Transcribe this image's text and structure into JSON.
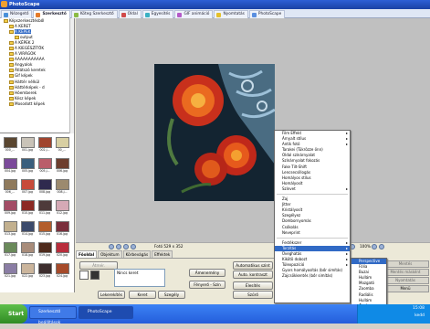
{
  "app": {
    "title": "PhotoScape"
  },
  "tabs": [
    {
      "label": "Nézegető",
      "color": "#4a90d9"
    },
    {
      "label": "Szerkesztő",
      "color": "#e47b2b"
    },
    {
      "label": "Köteg Szerkesztő",
      "color": "#8bbb45"
    },
    {
      "label": "Oldal",
      "color": "#d14a4a"
    },
    {
      "label": "Egyesítés",
      "color": "#3ab0c3"
    },
    {
      "label": "GIF animáció",
      "color": "#b45ac8"
    },
    {
      "label": "Nyomtatás",
      "color": "#e4c02b"
    },
    {
      "label": "PhotoScape",
      "color": "#5a8fe0"
    }
  ],
  "tree": [
    "Képszerkesztésből",
    "A KERET",
    "A KÉPEK",
    "output",
    "A KÉPEK 2",
    "A KIEGÉSZÍTŐK",
    "A VIRÁGOK",
    "AAAAAAAAAAA",
    "Angyalok",
    "Átlátszó keretek",
    "Gif képek",
    "Háttér nélkül",
    "Háttérképek - d",
    "Hóemberek",
    "Kész képek",
    "Mosodott képek"
  ],
  "thumbs": [
    {
      "cap": "000_...",
      "c": "#5a4630"
    },
    {
      "cap": "001.jpg",
      "c": "#c9c3b8"
    },
    {
      "cap": "002.j...",
      "c": "#a0442e"
    },
    {
      "cap": "00_...",
      "c": "#d8cfa2"
    },
    {
      "cap": "004.jpg",
      "c": "#7b4a9a"
    },
    {
      "cap": "005.jpg",
      "c": "#3a5f7d"
    },
    {
      "cap": "005.j...",
      "c": "#ba5d6a"
    },
    {
      "cap": "006.jpg",
      "c": "#6d3e2e"
    },
    {
      "cap": "006_...",
      "c": "#8f7a5c"
    },
    {
      "cap": "007.jpg",
      "c": "#c84b3a"
    },
    {
      "cap": "008.jpg",
      "c": "#2f2a4e"
    },
    {
      "cap": "008.j...",
      "c": "#9c8a6e"
    },
    {
      "cap": "009.jpg",
      "c": "#a34c65"
    },
    {
      "cap": "010.jpg",
      "c": "#8c2a24"
    },
    {
      "cap": "011.jpg",
      "c": "#4e3a3a"
    },
    {
      "cap": "012.jpg",
      "c": "#d5a9b5"
    },
    {
      "cap": "013.jpg",
      "c": "#c2b08e"
    },
    {
      "cap": "014.jpg",
      "c": "#3b4a6b"
    },
    {
      "cap": "015.jpg",
      "c": "#b35e2c"
    },
    {
      "cap": "016.jpg",
      "c": "#7a2f3c"
    },
    {
      "cap": "017.jpg",
      "c": "#6a8a5a"
    },
    {
      "cap": "018.jpg",
      "c": "#a88c7a"
    },
    {
      "cap": "019.jpg",
      "c": "#4e2a1c"
    },
    {
      "cap": "020.jpg",
      "c": "#b92d3c"
    },
    {
      "cap": "021.jpg",
      "c": "#8a7da4"
    },
    {
      "cap": "022.jpg",
      "c": "#cbb59c"
    },
    {
      "cap": "023.jpg",
      "c": "#3d2d2d"
    },
    {
      "cap": "024.jpg",
      "c": "#a64a2a"
    }
  ],
  "image_info": {
    "size": "Fotó 529 x 352",
    "file": "002-05/..."
  },
  "zoom": "100%",
  "editor": {
    "tabs": [
      "Főoldal",
      "Objektum",
      "Körbevágás",
      "Effektek"
    ],
    "frame_field": "Nincs keret",
    "buttons": {
      "rotate_left": "Lekerekítés",
      "frame": "Keret",
      "margin": "Szegély",
      "auto_level": "Automatikus szint",
      "auto_contrast": "Auto. kontraszt",
      "brighten": "Élesítés",
      "brightness": "Fényerő - Szín",
      "filter": "Szűrő",
      "contrast": "Ámenemény"
    }
  },
  "right_buttons": [
    "Mentés",
    "Mentés másként",
    "Nyomtatás",
    "Menü"
  ],
  "context_main": {
    "group1": [
      "Film Effekt",
      "Árnyalt stílus",
      "Antik fotó",
      "Tarakei (Tükrözze önn)",
      "Oldal színárnyalat",
      "Színárnyalat fokozás",
      "Fake Tilt-Shift",
      "Lencsecsillogás",
      "Homályos stílus",
      "Homályosít",
      "Színvet"
    ],
    "group2": [
      "Zaj",
      "Jitter",
      "Kristályosít",
      "Szegélyez",
      "Dombornyomás",
      "Csókolás",
      "Neveprint"
    ],
    "group3": [
      "Festékszer",
      "Torzítás",
      "Üveghatás",
      "Kikötö dobozt",
      "Túlexpozíció",
      "Gyors homályosítás (bőr simítás)",
      "Zajcsökkentés (bőr simítás)"
    ]
  },
  "context_sub": [
    "Perspective",
    "Fólia",
    "Buzai",
    "Hullám",
    "Mozgató",
    "Zoomba",
    "Radiális",
    "Hullám",
    "Örvény"
  ],
  "taskbar": {
    "start": "Start",
    "items": [
      "Szerkesztő beállítások",
      "PhotoScape"
    ],
    "clock": "15:08",
    "day": "kedd"
  }
}
